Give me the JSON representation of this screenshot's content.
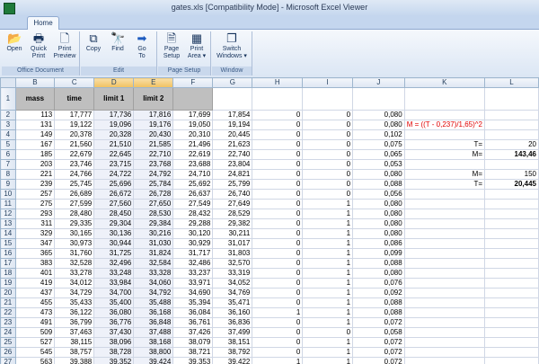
{
  "window": {
    "title": "gates.xls  [Compatibility Mode] - Microsoft Excel Viewer"
  },
  "tabs": {
    "home": "Home"
  },
  "ribbon": {
    "groups": [
      {
        "label": "Office Document",
        "buttons": [
          {
            "label": "Open",
            "icon": "folder-icon"
          },
          {
            "label": "Quick\nPrint",
            "icon": "printer-icon"
          },
          {
            "label": "Print\nPreview",
            "icon": "preview-icon"
          }
        ]
      },
      {
        "label": "Edit",
        "buttons": [
          {
            "label": "Copy",
            "icon": "copy-icon"
          },
          {
            "label": "Find",
            "icon": "binoculars-icon"
          },
          {
            "label": "Go\nTo",
            "icon": "arrow-right-icon"
          }
        ]
      },
      {
        "label": "Page Setup",
        "buttons": [
          {
            "label": "Page\nSetup",
            "icon": "page-setup-icon"
          },
          {
            "label": "Print\nArea ▾",
            "icon": "print-area-icon"
          }
        ]
      },
      {
        "label": "Window",
        "buttons": [
          {
            "label": "Switch\nWindows ▾",
            "icon": "windows-icon"
          }
        ]
      }
    ]
  },
  "grid": {
    "columns": [
      "B",
      "C",
      "D",
      "E",
      "F",
      "G",
      "H",
      "I",
      "J",
      "K",
      "L"
    ],
    "selected_columns": [
      "D",
      "E"
    ],
    "header_row": {
      "row": "1",
      "cells": [
        "mass",
        "time",
        "limit 1",
        "limit 2",
        ""
      ]
    },
    "rows": [
      {
        "n": "2",
        "c": [
          "113",
          "17,777",
          "17,736",
          "17,816",
          "17,699",
          "17,854",
          "0",
          "0",
          "0,080",
          "",
          ""
        ]
      },
      {
        "n": "3",
        "c": [
          "131",
          "19,122",
          "19,096",
          "19,176",
          "19,050",
          "19,194",
          "0",
          "0",
          "0,080",
          "M = ((T - 0,237)/1,65)^2",
          ""
        ]
      },
      {
        "n": "4",
        "c": [
          "149",
          "20,378",
          "20,328",
          "20,430",
          "20,310",
          "20,445",
          "0",
          "0",
          "0,102",
          "",
          ""
        ]
      },
      {
        "n": "5",
        "c": [
          "167",
          "21,560",
          "21,510",
          "21,585",
          "21,496",
          "21,623",
          "0",
          "0",
          "0,075",
          "T=",
          "20"
        ]
      },
      {
        "n": "6",
        "c": [
          "185",
          "22,679",
          "22,645",
          "22,710",
          "22,619",
          "22,740",
          "0",
          "0",
          "0,065",
          "M=",
          "143,46"
        ]
      },
      {
        "n": "7",
        "c": [
          "203",
          "23,746",
          "23,715",
          "23,768",
          "23,688",
          "23,804",
          "0",
          "0",
          "0,053",
          "",
          ""
        ]
      },
      {
        "n": "8",
        "c": [
          "221",
          "24,766",
          "24,722",
          "24,792",
          "24,710",
          "24,821",
          "0",
          "0",
          "0,080",
          "M=",
          "150"
        ]
      },
      {
        "n": "9",
        "c": [
          "239",
          "25,745",
          "25,696",
          "25,784",
          "25,692",
          "25,799",
          "0",
          "0",
          "0,088",
          "T=",
          "20,445"
        ]
      },
      {
        "n": "10",
        "c": [
          "257",
          "26,689",
          "26,672",
          "26,728",
          "26,637",
          "26,740",
          "0",
          "0",
          "0,056",
          "",
          ""
        ]
      },
      {
        "n": "11",
        "c": [
          "275",
          "27,599",
          "27,560",
          "27,650",
          "27,549",
          "27,649",
          "0",
          "1",
          "0,080",
          "",
          ""
        ]
      },
      {
        "n": "12",
        "c": [
          "293",
          "28,480",
          "28,450",
          "28,530",
          "28,432",
          "28,529",
          "0",
          "1",
          "0,080",
          "",
          ""
        ]
      },
      {
        "n": "13",
        "c": [
          "311",
          "29,335",
          "29,304",
          "29,384",
          "29,288",
          "29,382",
          "0",
          "1",
          "0,080",
          "",
          ""
        ]
      },
      {
        "n": "14",
        "c": [
          "329",
          "30,165",
          "30,136",
          "30,216",
          "30,120",
          "30,211",
          "0",
          "1",
          "0,080",
          "",
          ""
        ]
      },
      {
        "n": "15",
        "c": [
          "347",
          "30,973",
          "30,944",
          "31,030",
          "30,929",
          "31,017",
          "0",
          "1",
          "0,086",
          "",
          ""
        ]
      },
      {
        "n": "16",
        "c": [
          "365",
          "31,760",
          "31,725",
          "31,824",
          "31,717",
          "31,803",
          "0",
          "1",
          "0,099",
          "",
          ""
        ]
      },
      {
        "n": "17",
        "c": [
          "383",
          "32,528",
          "32,496",
          "32,584",
          "32,486",
          "32,570",
          "0",
          "1",
          "0,088",
          "",
          ""
        ]
      },
      {
        "n": "18",
        "c": [
          "401",
          "33,278",
          "33,248",
          "33,328",
          "33,237",
          "33,319",
          "0",
          "1",
          "0,080",
          "",
          ""
        ]
      },
      {
        "n": "19",
        "c": [
          "419",
          "34,012",
          "33,984",
          "34,060",
          "33,971",
          "34,052",
          "0",
          "1",
          "0,076",
          "",
          ""
        ]
      },
      {
        "n": "20",
        "c": [
          "437",
          "34,729",
          "34,700",
          "34,792",
          "34,690",
          "34,769",
          "0",
          "1",
          "0,092",
          "",
          ""
        ]
      },
      {
        "n": "21",
        "c": [
          "455",
          "35,433",
          "35,400",
          "35,488",
          "35,394",
          "35,471",
          "0",
          "1",
          "0,088",
          "",
          ""
        ]
      },
      {
        "n": "22",
        "c": [
          "473",
          "36,122",
          "36,080",
          "36,168",
          "36,084",
          "36,160",
          "1",
          "1",
          "0,088",
          "",
          ""
        ]
      },
      {
        "n": "23",
        "c": [
          "491",
          "36,799",
          "36,776",
          "36,848",
          "36,761",
          "36,836",
          "0",
          "1",
          "0,072",
          "",
          ""
        ]
      },
      {
        "n": "24",
        "c": [
          "509",
          "37,463",
          "37,430",
          "37,488",
          "37,426",
          "37,499",
          "0",
          "0",
          "0,058",
          "",
          ""
        ]
      },
      {
        "n": "25",
        "c": [
          "527",
          "38,115",
          "38,096",
          "38,168",
          "38,079",
          "38,151",
          "0",
          "1",
          "0,072",
          "",
          ""
        ]
      },
      {
        "n": "26",
        "c": [
          "545",
          "38,757",
          "38,728",
          "38,800",
          "38,721",
          "38,792",
          "0",
          "1",
          "0,072",
          "",
          ""
        ]
      },
      {
        "n": "27",
        "c": [
          "563",
          "39,388",
          "39,352",
          "39,424",
          "39,353",
          "39,422",
          "1",
          "1",
          "0,072",
          "",
          ""
        ]
      }
    ]
  }
}
